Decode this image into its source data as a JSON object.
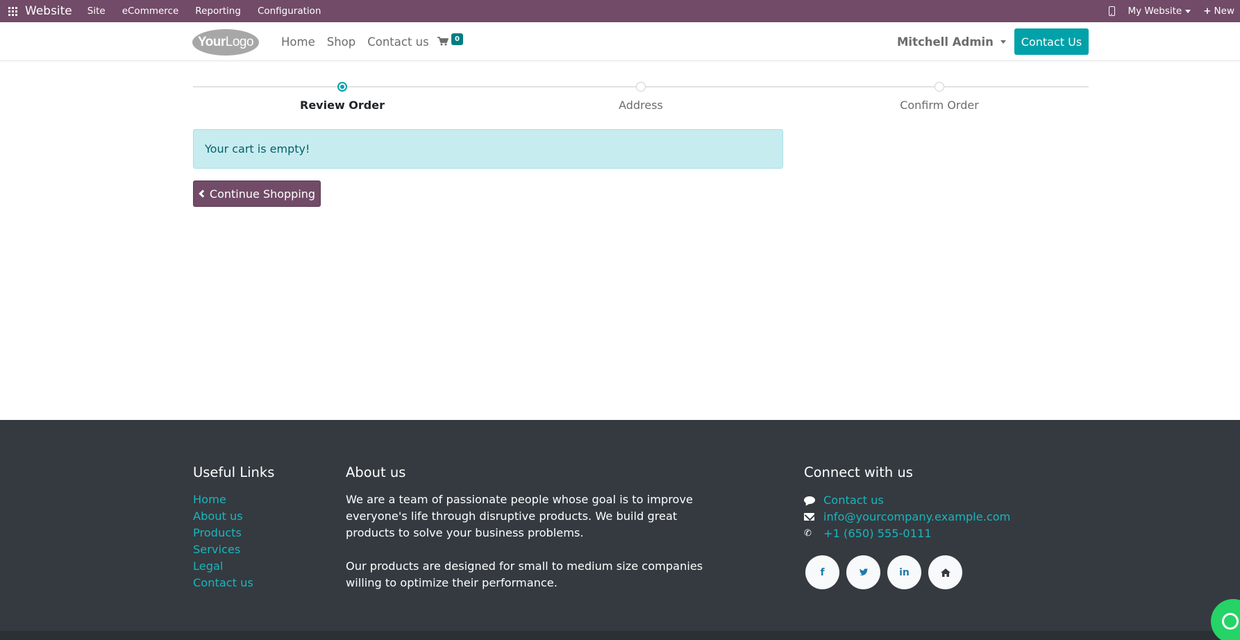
{
  "admin_bar": {
    "app_name": "Website",
    "menus": [
      "Site",
      "eCommerce",
      "Reporting",
      "Configuration"
    ],
    "website_switcher": "My Website",
    "new_label": "New",
    "bg_color": "#714B67"
  },
  "header": {
    "logo_text_bold": "Your",
    "logo_text": "Logo",
    "nav": [
      "Home",
      "Shop",
      "Contact us"
    ],
    "cart_count": "0",
    "user_name": "Mitchell Admin",
    "contact_button": "Contact Us",
    "accent_color": "#01A1A9"
  },
  "wizard": {
    "steps": [
      {
        "label": "Review Order",
        "active": true
      },
      {
        "label": "Address",
        "active": false
      },
      {
        "label": "Confirm Order",
        "active": false
      }
    ]
  },
  "cart": {
    "empty_message": "Your cart is empty!",
    "continue_label": "Continue Shopping"
  },
  "footer": {
    "useful_links": {
      "title": "Useful Links",
      "links": [
        "Home",
        "About us",
        "Products",
        "Services",
        "Legal",
        "Contact us"
      ]
    },
    "about": {
      "title": "About us",
      "p1": "We are a team of passionate people whose goal is to improve everyone's life through disruptive products. We build great products to solve your business problems.",
      "p2": "Our products are designed for small to medium size companies willing to optimize their performance."
    },
    "connect": {
      "title": "Connect with us",
      "contact_link": "Contact us",
      "email": "info@yourcompany.example.com",
      "phone": "+1 (650) 555-0111",
      "socials": [
        "facebook-icon",
        "twitter-icon",
        "linkedin-icon",
        "home-icon"
      ]
    },
    "bg_color": "#343A40"
  }
}
